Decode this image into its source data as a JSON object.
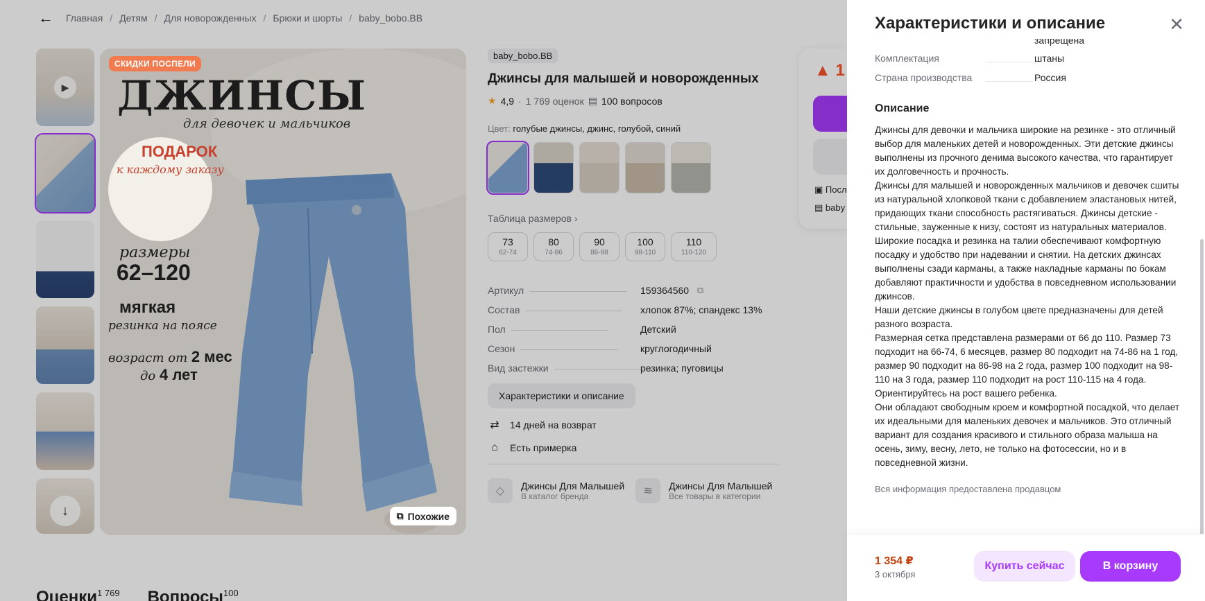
{
  "breadcrumbs": [
    "Главная",
    "Детям",
    "Для новорожденных",
    "Брюки и шорты",
    "baby_bobo.BB"
  ],
  "photo": {
    "sale_badge": "СКИДКИ ПОСПЕЛИ",
    "title": "ДЖИНСЫ",
    "subtitle": "для девочек и мальчиков",
    "gift_title": "ПОДАРОК",
    "gift_sub": "к каждому заказу",
    "sizes_label": "размеры",
    "sizes_value": "62–120",
    "soft": "мягкая",
    "soft_sub": "резинка на поясе",
    "age_prefix": "возраст от",
    "age_from": "2 мес",
    "age_to_prefix": "до",
    "age_to": "4 лет",
    "similar_label": "Похожие"
  },
  "product": {
    "brand": "baby_bobo.BB",
    "title": "Джинсы для малышей и новорожденных",
    "rating": "4,9",
    "reviews": "1 769 оценок",
    "questions": "100 вопросов",
    "color_label": "Цвет:",
    "color_value": "голубые джинсы, джинс, голубой, синий",
    "size_table_link": "Таблица размеров",
    "sizes": [
      {
        "n": "73",
        "r": "62-74"
      },
      {
        "n": "80",
        "r": "74-86"
      },
      {
        "n": "90",
        "r": "86-98"
      },
      {
        "n": "100",
        "r": "98-110"
      },
      {
        "n": "110",
        "r": "110-120"
      }
    ],
    "specs": [
      {
        "k": "Артикул",
        "v": "159364560"
      },
      {
        "k": "Состав",
        "v": "хлопок 87%; спандекс 13%"
      },
      {
        "k": "Пол",
        "v": "Детский"
      },
      {
        "k": "Сезон",
        "v": "круглогодичный"
      },
      {
        "k": "Вид застежки",
        "v": "резинка; пуговицы"
      }
    ],
    "chars_button": "Характеристики и описание",
    "perk_return": "14 дней на возврат",
    "perk_fitting": "Есть примерка",
    "brand_cards": [
      {
        "t": "Джинсы Для Малышей",
        "s": "В каталог бренда"
      },
      {
        "t": "Джинсы Для Малышей",
        "s": "Все товары в категории"
      }
    ]
  },
  "buy_box": {
    "price": "1",
    "line1": "Посл",
    "line2": "baby"
  },
  "tabs": [
    {
      "label": "Оценки",
      "count": "1 769"
    },
    {
      "label": "Вопросы",
      "count": "100"
    }
  ],
  "panel": {
    "title": "Характеристики и описание",
    "cut_value": "запрещена",
    "specs": [
      {
        "k": "Комплектация",
        "v": "штаны"
      },
      {
        "k": "Страна производства",
        "v": "Россия"
      }
    ],
    "desc_title": "Описание",
    "desc_text": "Джинсы для девочки и мальчика широкие на резинке - это отличный выбор для маленьких детей и новорожденных. Эти детские джинсы выполнены из прочного денима высокого качества, что гарантирует их долговечность и прочность.\nДжинсы для малышей и новорожденных мальчиков и девочек сшиты из натуральной хлопковой ткани с добавлением эластановых нитей, придающих ткани способность растягиваться. Джинсы детские - стильные, зауженные к низу, состоят из натуральных материалов. Широкие посадка и резинка на талии обеспечивают комфортную посадку и удобство при надевании и снятии. На детских джинсах выполнены сзади карманы, а также накладные карманы по бокам добавляют практичности и удобства в повседневном использовании джинсов.\nНаши детские джинсы в голубом цвете предназначены для детей разного возраста.\nРазмерная сетка представлена размерами от 66 до 110. Размер 73 подходит на 66-74, 6 месяцев, размер 80 подходит на 74-86 на 1 год, размер 90 подходит на 86-98 на 2 года, размер 100 подходит на 98-110 на 3 года, размер 110 подходит на рост 110-115 на 4 года. Ориентируйтесь на рост вашего ребенка.\nОни обладают свободным кроем и комфортной посадкой, что делает их идеальными для маленьких девочек и мальчиков. Это отличный вариант для создания красивого и стильного образа малыша на осень, зиму, весну, лето, не только на фотосессии, но и в повседневной жизни.",
    "note": "Вся информация предоставлена продавцом",
    "footer": {
      "price": "1 354 ₽",
      "date": "3 октября",
      "buy_now": "Купить сейчас",
      "to_cart": "В корзину"
    }
  },
  "colors": {
    "accent": "#a73afd",
    "accent_light": "#f5e6ff",
    "price_orange": "#c2410c",
    "sale_badge": "#f27a4f"
  }
}
